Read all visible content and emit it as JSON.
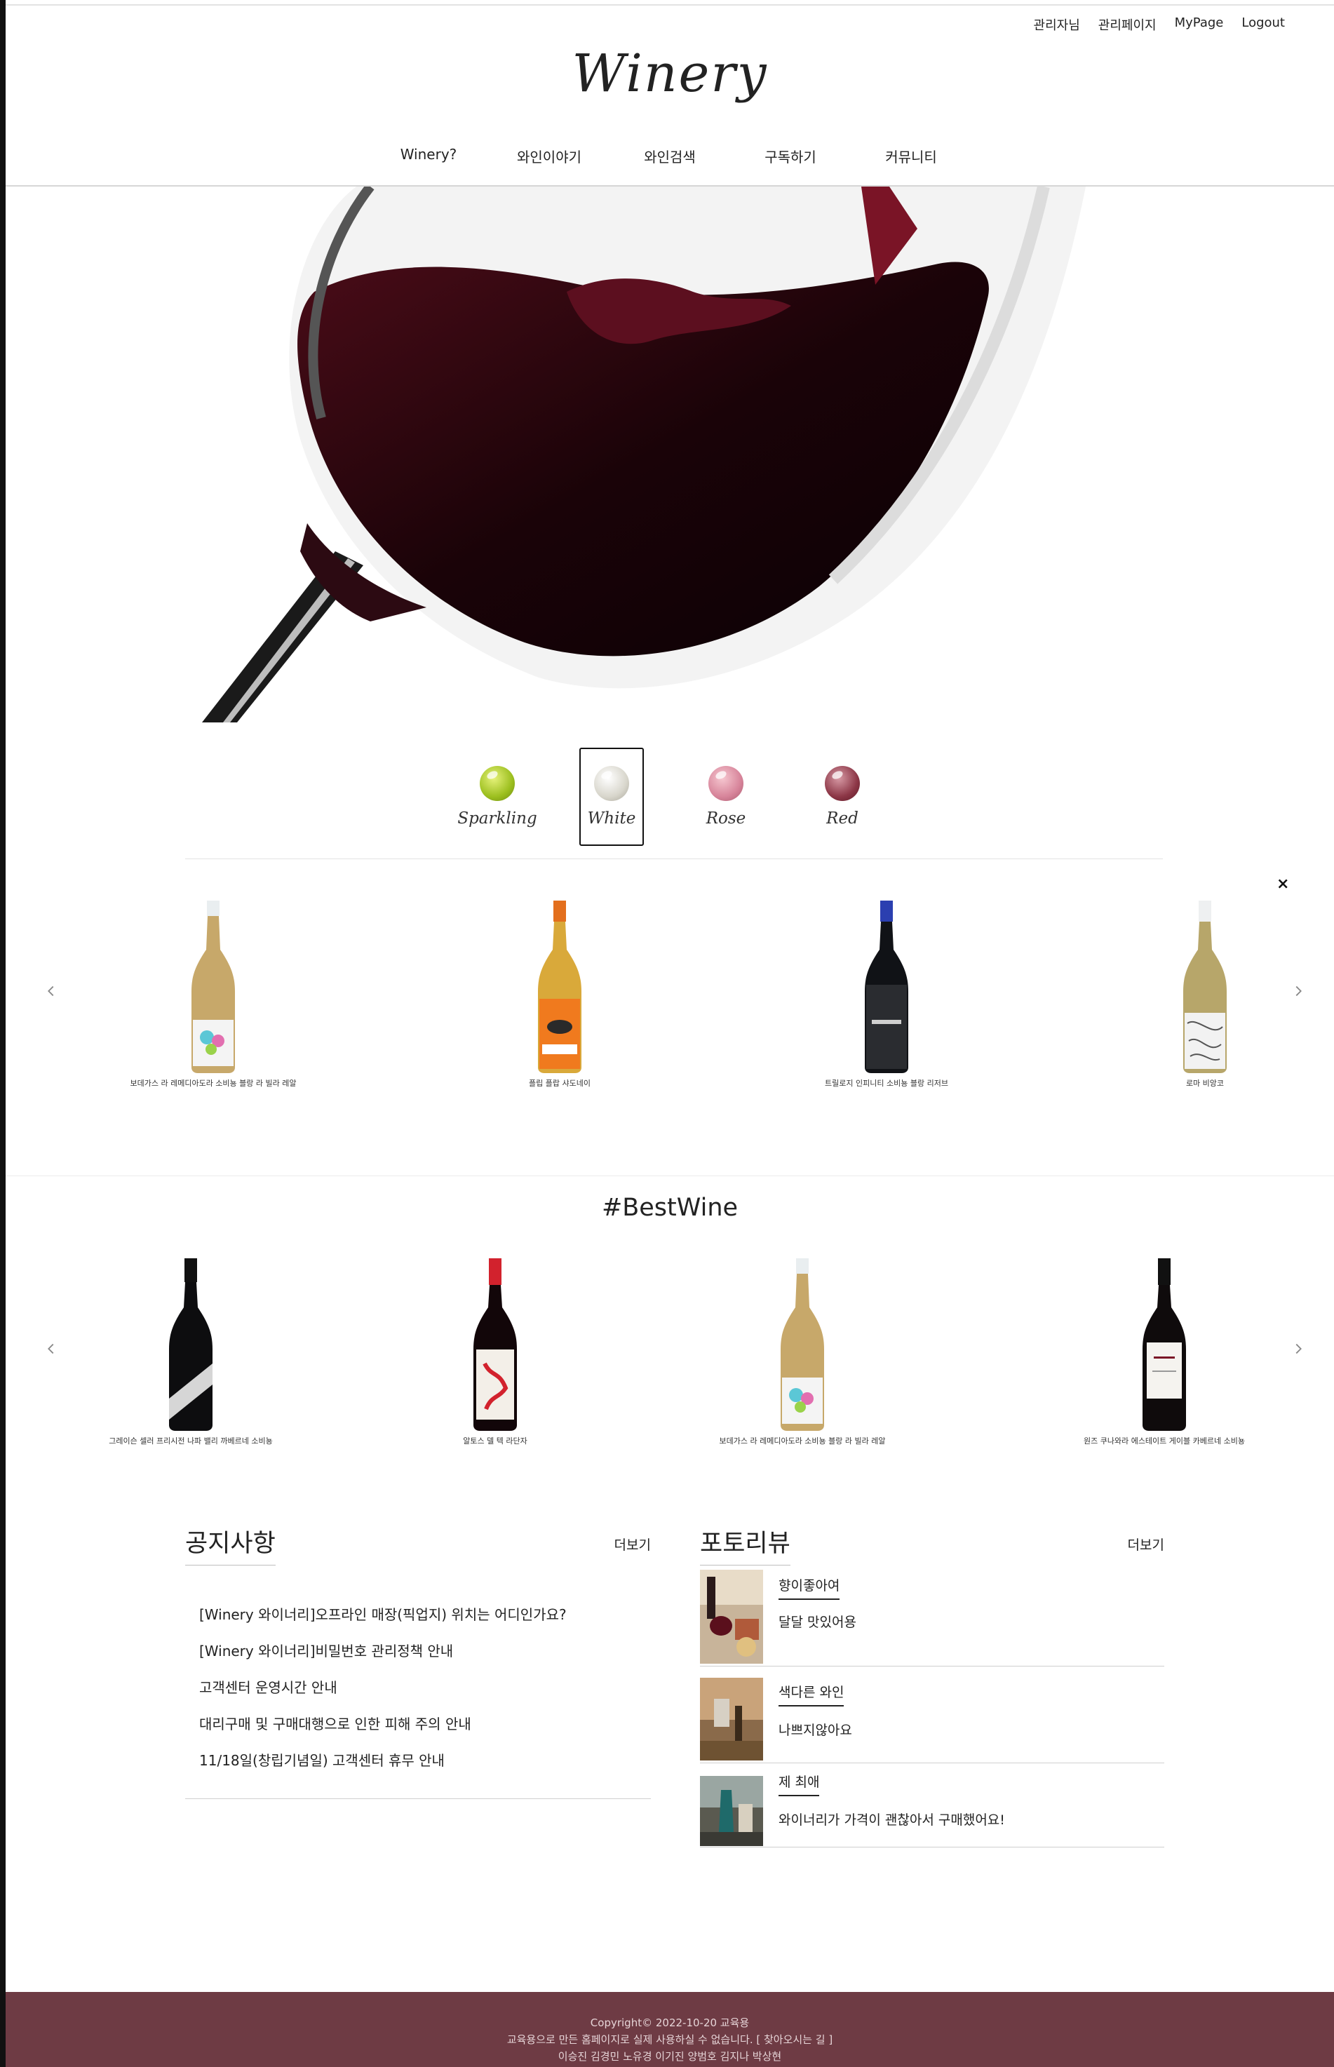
{
  "header": {
    "user_links": [
      "관리자님",
      "관리페이지",
      "MyPage",
      "Logout"
    ],
    "logo_text": "Winery",
    "nav": [
      "Winery?",
      "와인이야기",
      "와인검색",
      "구독하기",
      "커뮤니티"
    ]
  },
  "wine_types": {
    "items": [
      {
        "label": "Sparkling",
        "color": "#b4d23a"
      },
      {
        "label": "White",
        "color": "#dcd9d0"
      },
      {
        "label": "Rose",
        "color": "#d88d9b"
      },
      {
        "label": "Red",
        "color": "#8c3646"
      }
    ],
    "selected": "White"
  },
  "type_slider": {
    "close_label": "×",
    "products": [
      "보데가스 라 레메디아도라 소비뇽 블랑 라 빌라 레알",
      "플립 플랍 샤도네이",
      "트릴로지 인피니티 소비뇽 블랑 리저브",
      "로마 비앙코"
    ]
  },
  "best": {
    "title": "#BestWine",
    "products": [
      "그레이슨 셀러 프리시전 나파 밸리 까베르네 소비뇽",
      "알토스 델 텍 라단자",
      "보데가스 라 레메디아도라 소비뇽 블랑 라 빌라 레알",
      "원즈 쿠나와라 에스테이트 게이블 카베르네 소비뇽"
    ]
  },
  "notice": {
    "title": "공지사항",
    "more_label": "더보기",
    "items": [
      "[Winery 와이너리]오프라인 매장(픽업지) 위치는 어디인가요?",
      "[Winery 와이너리]비밀번호 관리정책 안내",
      "고객센터 운영시간 안내",
      "대리구매 및 구매대행으로 인한 피해 주의 안내",
      "11/18일(창립기념일) 고객센터 휴무 안내"
    ]
  },
  "photo_review": {
    "title": "포토리뷰",
    "more_label": "더보기",
    "items": [
      {
        "user": "향이좋아여",
        "text": "달달 맛있어용"
      },
      {
        "user": "색다른 와인",
        "text": "나쁘지않아요"
      },
      {
        "user": "제 최애",
        "text": "와이너리가 가격이 괜찮아서 구매했어요!"
      }
    ]
  },
  "footer": {
    "copyright": "Copyright© 2022-10-20 교육용",
    "notice": "교육용으로 만든 홈페이지로 실제 사용하실 수 없습니다. [ 찾아오시는 길 ]",
    "members": "이승진 김경민 노유경 이기진 양범호 김지나 박상현"
  },
  "colors": {
    "footer_bg": "#6e3b44",
    "wine_red": "#3a0a14"
  }
}
